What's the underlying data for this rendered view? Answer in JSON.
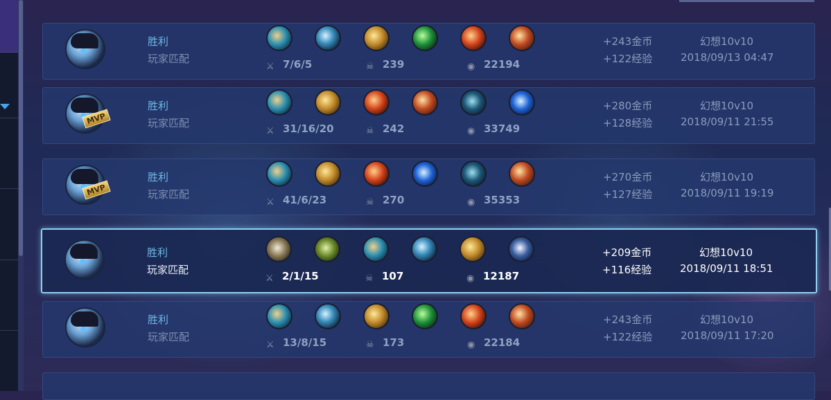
{
  "matches": [
    {
      "result": "胜利",
      "mode": "玩家匹配",
      "mvp": false,
      "items": [
        {
          "icon": "teal-boots-icon",
          "t": "t-teal"
        },
        {
          "icon": "trident-icon",
          "t": "t-blue"
        },
        {
          "icon": "gold-claw-icon",
          "t": "t-gold"
        },
        {
          "icon": "green-blade-icon",
          "t": "t-green"
        },
        {
          "icon": "fire-sword-icon",
          "t": "t-red"
        },
        {
          "icon": "crest-icon",
          "t": "t-crest"
        }
      ],
      "kda": "7/6/5",
      "cs": "239",
      "gold": "22194",
      "gold_reward": "+243金币",
      "exp_reward": "+122经验",
      "map": "幻想10v10",
      "time": "2018/09/13 04:47"
    },
    {
      "result": "胜利",
      "mode": "玩家匹配",
      "mvp": true,
      "items": [
        {
          "icon": "teal-boots-icon",
          "t": "t-teal"
        },
        {
          "icon": "gold-claw-icon",
          "t": "t-gold"
        },
        {
          "icon": "fire-sword-icon",
          "t": "t-red"
        },
        {
          "icon": "crest-icon",
          "t": "t-crest"
        },
        {
          "icon": "rune-icon",
          "t": "t-rune"
        },
        {
          "icon": "lightning-sword-icon",
          "t": "t-bolt"
        }
      ],
      "kda": "31/16/20",
      "cs": "242",
      "gold": "33749",
      "gold_reward": "+280金币",
      "exp_reward": "+128经验",
      "map": "幻想10v10",
      "time": "2018/09/11 21:55"
    },
    {
      "result": "胜利",
      "mode": "玩家匹配",
      "mvp": true,
      "items": [
        {
          "icon": "teal-boots-icon",
          "t": "t-teal"
        },
        {
          "icon": "gold-claw-icon",
          "t": "t-gold"
        },
        {
          "icon": "fire-sword-icon",
          "t": "t-red"
        },
        {
          "icon": "lightning-sword-icon",
          "t": "t-bolt"
        },
        {
          "icon": "rune-icon",
          "t": "t-rune"
        },
        {
          "icon": "crest-icon",
          "t": "t-crest"
        }
      ],
      "kda": "41/6/23",
      "cs": "270",
      "gold": "35353",
      "gold_reward": "+270金币",
      "exp_reward": "+127经验",
      "map": "幻想10v10",
      "time": "2018/09/11 19:19"
    },
    {
      "result": "胜利",
      "mode": "玩家匹配",
      "mvp": false,
      "selected": true,
      "items": [
        {
          "icon": "iron-sword-icon",
          "t": "t-iron"
        },
        {
          "icon": "olive-blade-icon",
          "t": "t-olive"
        },
        {
          "icon": "teal-boots-icon",
          "t": "t-teal"
        },
        {
          "icon": "trident-icon",
          "t": "t-blue"
        },
        {
          "icon": "gold-claw-icon",
          "t": "t-gold"
        },
        {
          "icon": "hook-icon",
          "t": "t-hook"
        }
      ],
      "kda": "2/1/15",
      "cs": "107",
      "gold": "12187",
      "gold_reward": "+209金币",
      "exp_reward": "+116经验",
      "map": "幻想10v10",
      "time": "2018/09/11 18:51"
    },
    {
      "result": "胜利",
      "mode": "玩家匹配",
      "mvp": false,
      "items": [
        {
          "icon": "teal-boots-icon",
          "t": "t-teal"
        },
        {
          "icon": "trident-icon",
          "t": "t-blue"
        },
        {
          "icon": "gold-claw-icon",
          "t": "t-gold"
        },
        {
          "icon": "green-blade-icon",
          "t": "t-green"
        },
        {
          "icon": "fire-sword-icon",
          "t": "t-red"
        },
        {
          "icon": "crest-icon",
          "t": "t-crest"
        }
      ],
      "kda": "13/8/15",
      "cs": "173",
      "gold": "22184",
      "gold_reward": "+243金币",
      "exp_reward": "+122经验",
      "map": "幻想10v10",
      "time": "2018/09/11 17:20"
    }
  ],
  "mvp_label": "MVP",
  "colors": {
    "result": "#6fb8e6",
    "row_bg": "#24386e",
    "selected_border": "#8fd0f0"
  }
}
